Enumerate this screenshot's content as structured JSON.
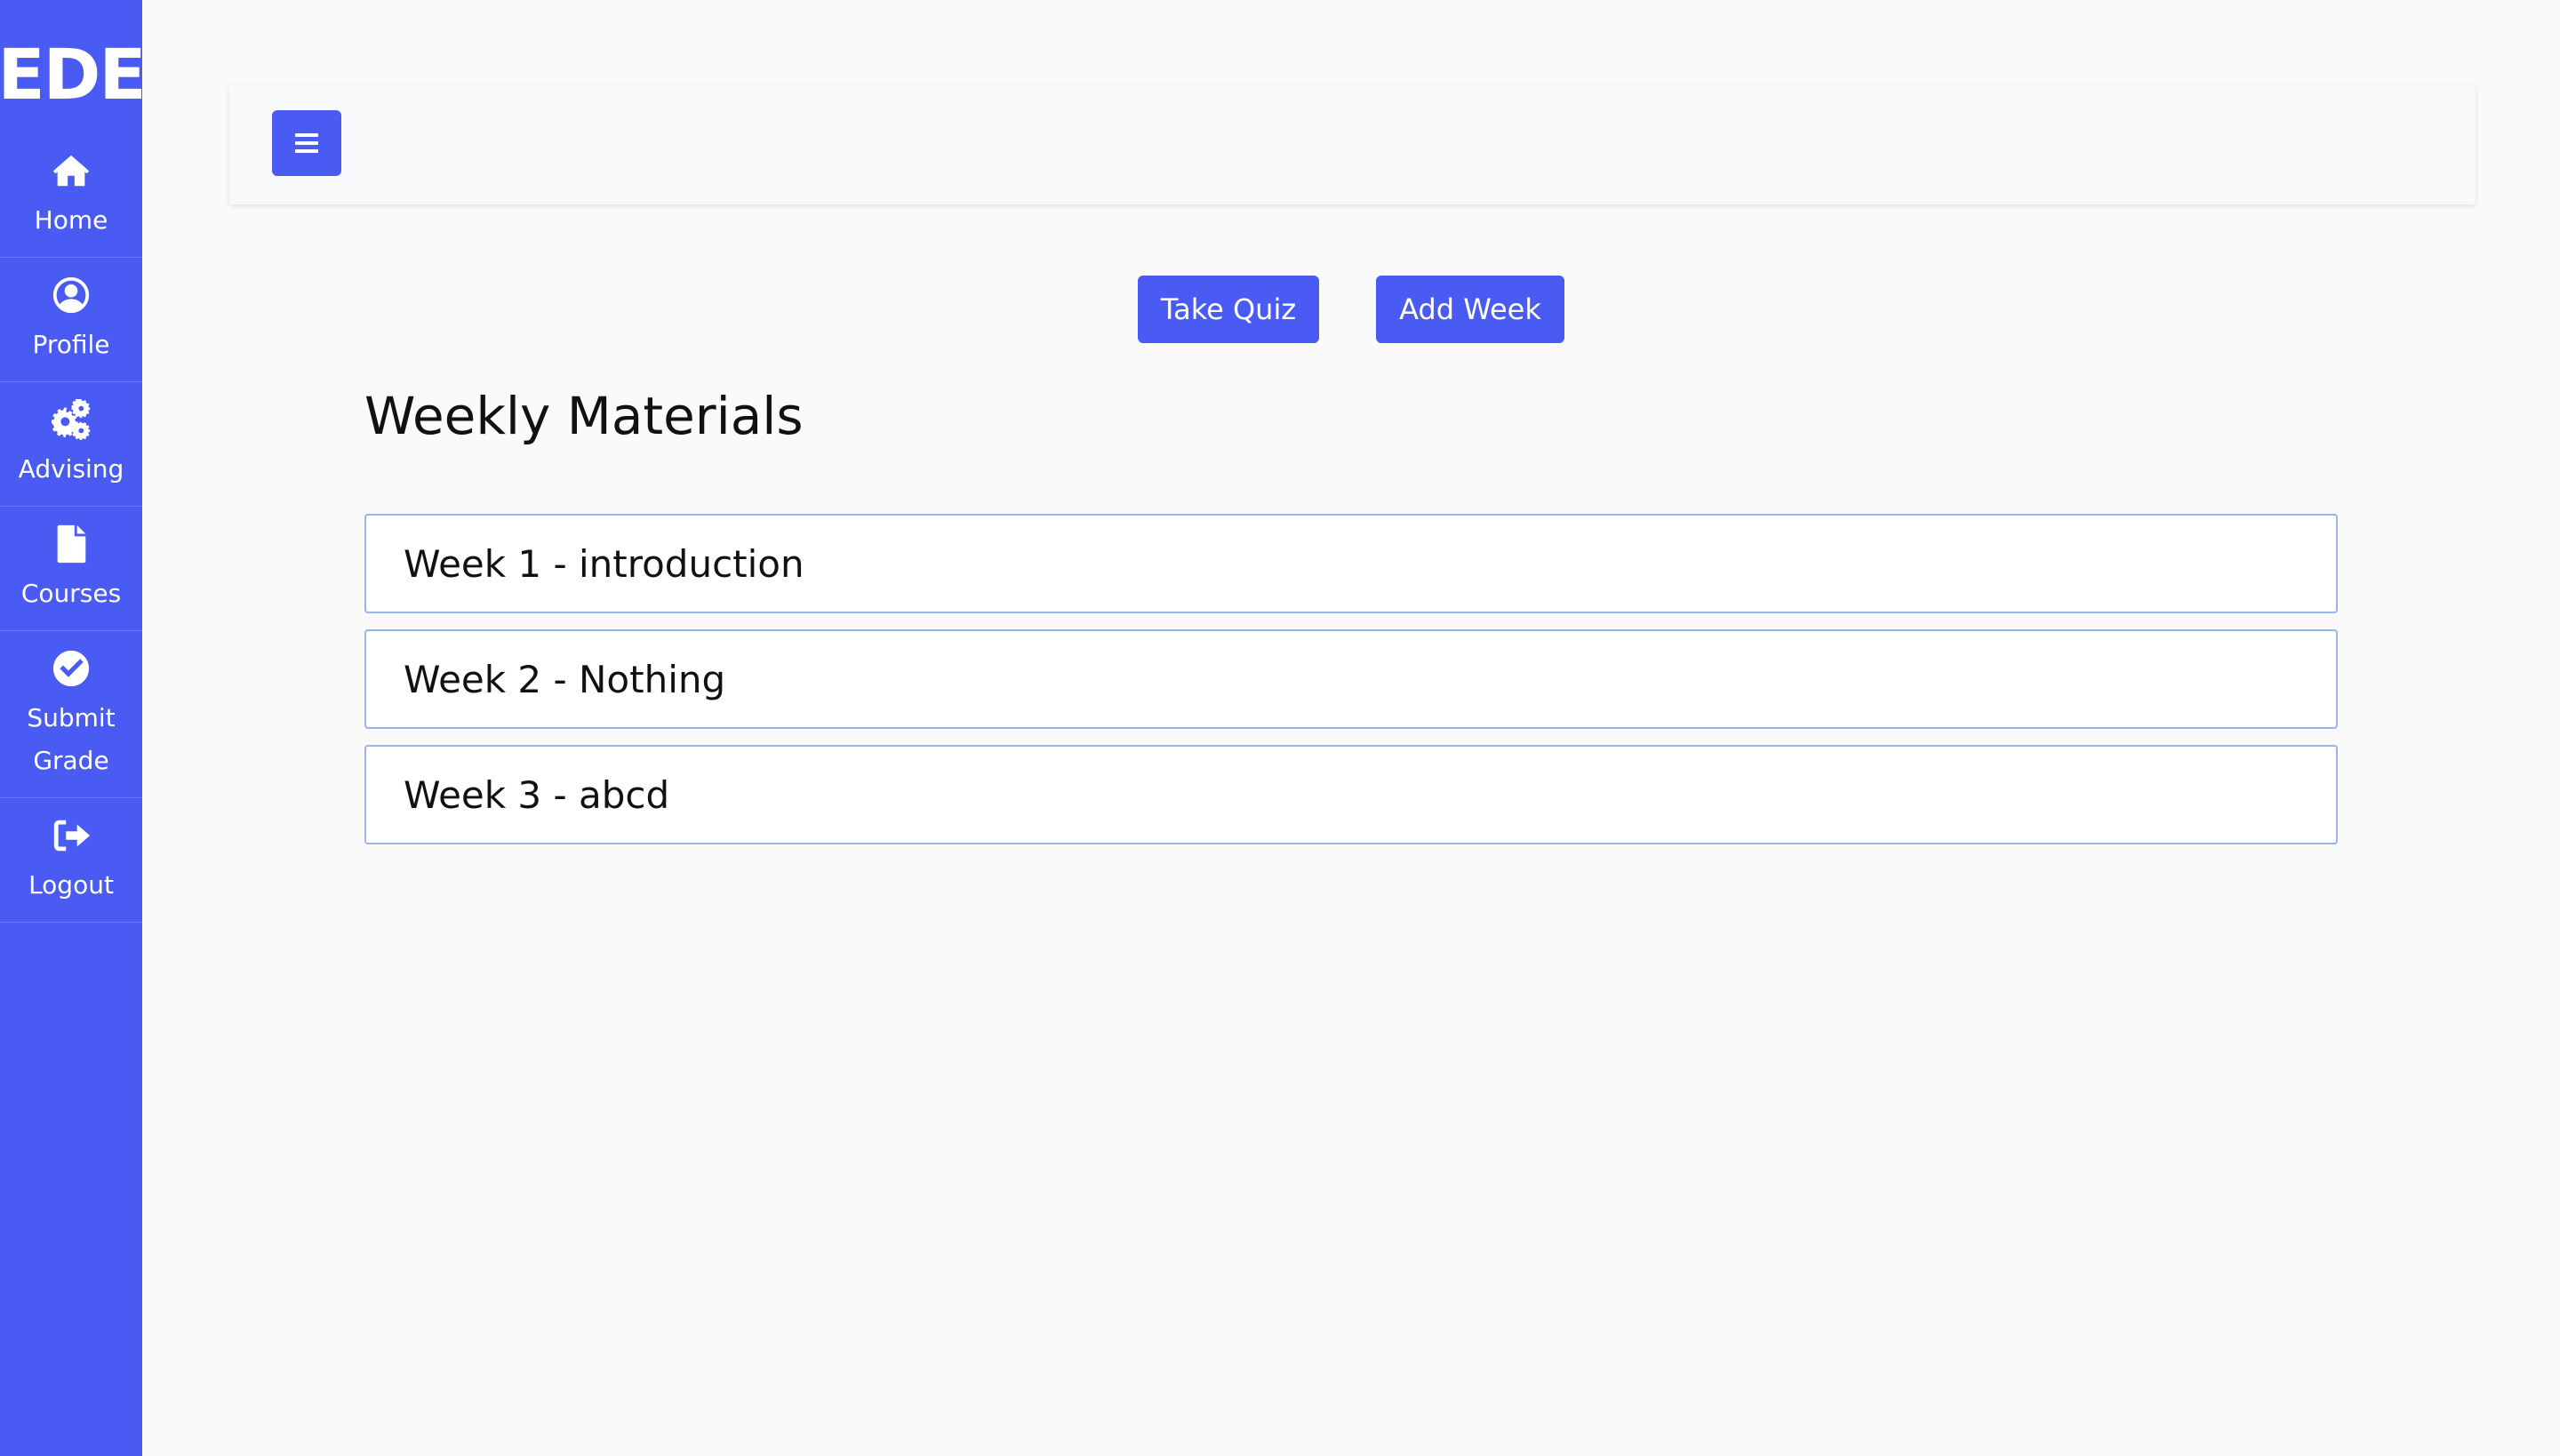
{
  "brand": {
    "logo_text": "EDE"
  },
  "sidebar": {
    "items": [
      {
        "label": "Home",
        "icon": "home-icon"
      },
      {
        "label": "Profile",
        "icon": "user-circle-icon"
      },
      {
        "label": "Advising",
        "icon": "gears-icon"
      },
      {
        "label": "Courses",
        "icon": "file-icon"
      },
      {
        "label_line1": "Submit",
        "label_line2": "Grade",
        "icon": "check-circle-icon"
      },
      {
        "label": "Logout",
        "icon": "sign-out-icon"
      }
    ]
  },
  "topbar": {
    "menu_icon": "hamburger-icon"
  },
  "actions": {
    "take_quiz": "Take Quiz",
    "add_week": "Add Week"
  },
  "main": {
    "heading": "Weekly Materials",
    "weeks": [
      {
        "title": "Week 1 - introduction"
      },
      {
        "title": "Week 2 - Nothing"
      },
      {
        "title": "Week 3 - abcd"
      }
    ]
  },
  "colors": {
    "accent": "#4a5bf4",
    "background": "#fafafa",
    "card_border": "#9ab4ec"
  }
}
